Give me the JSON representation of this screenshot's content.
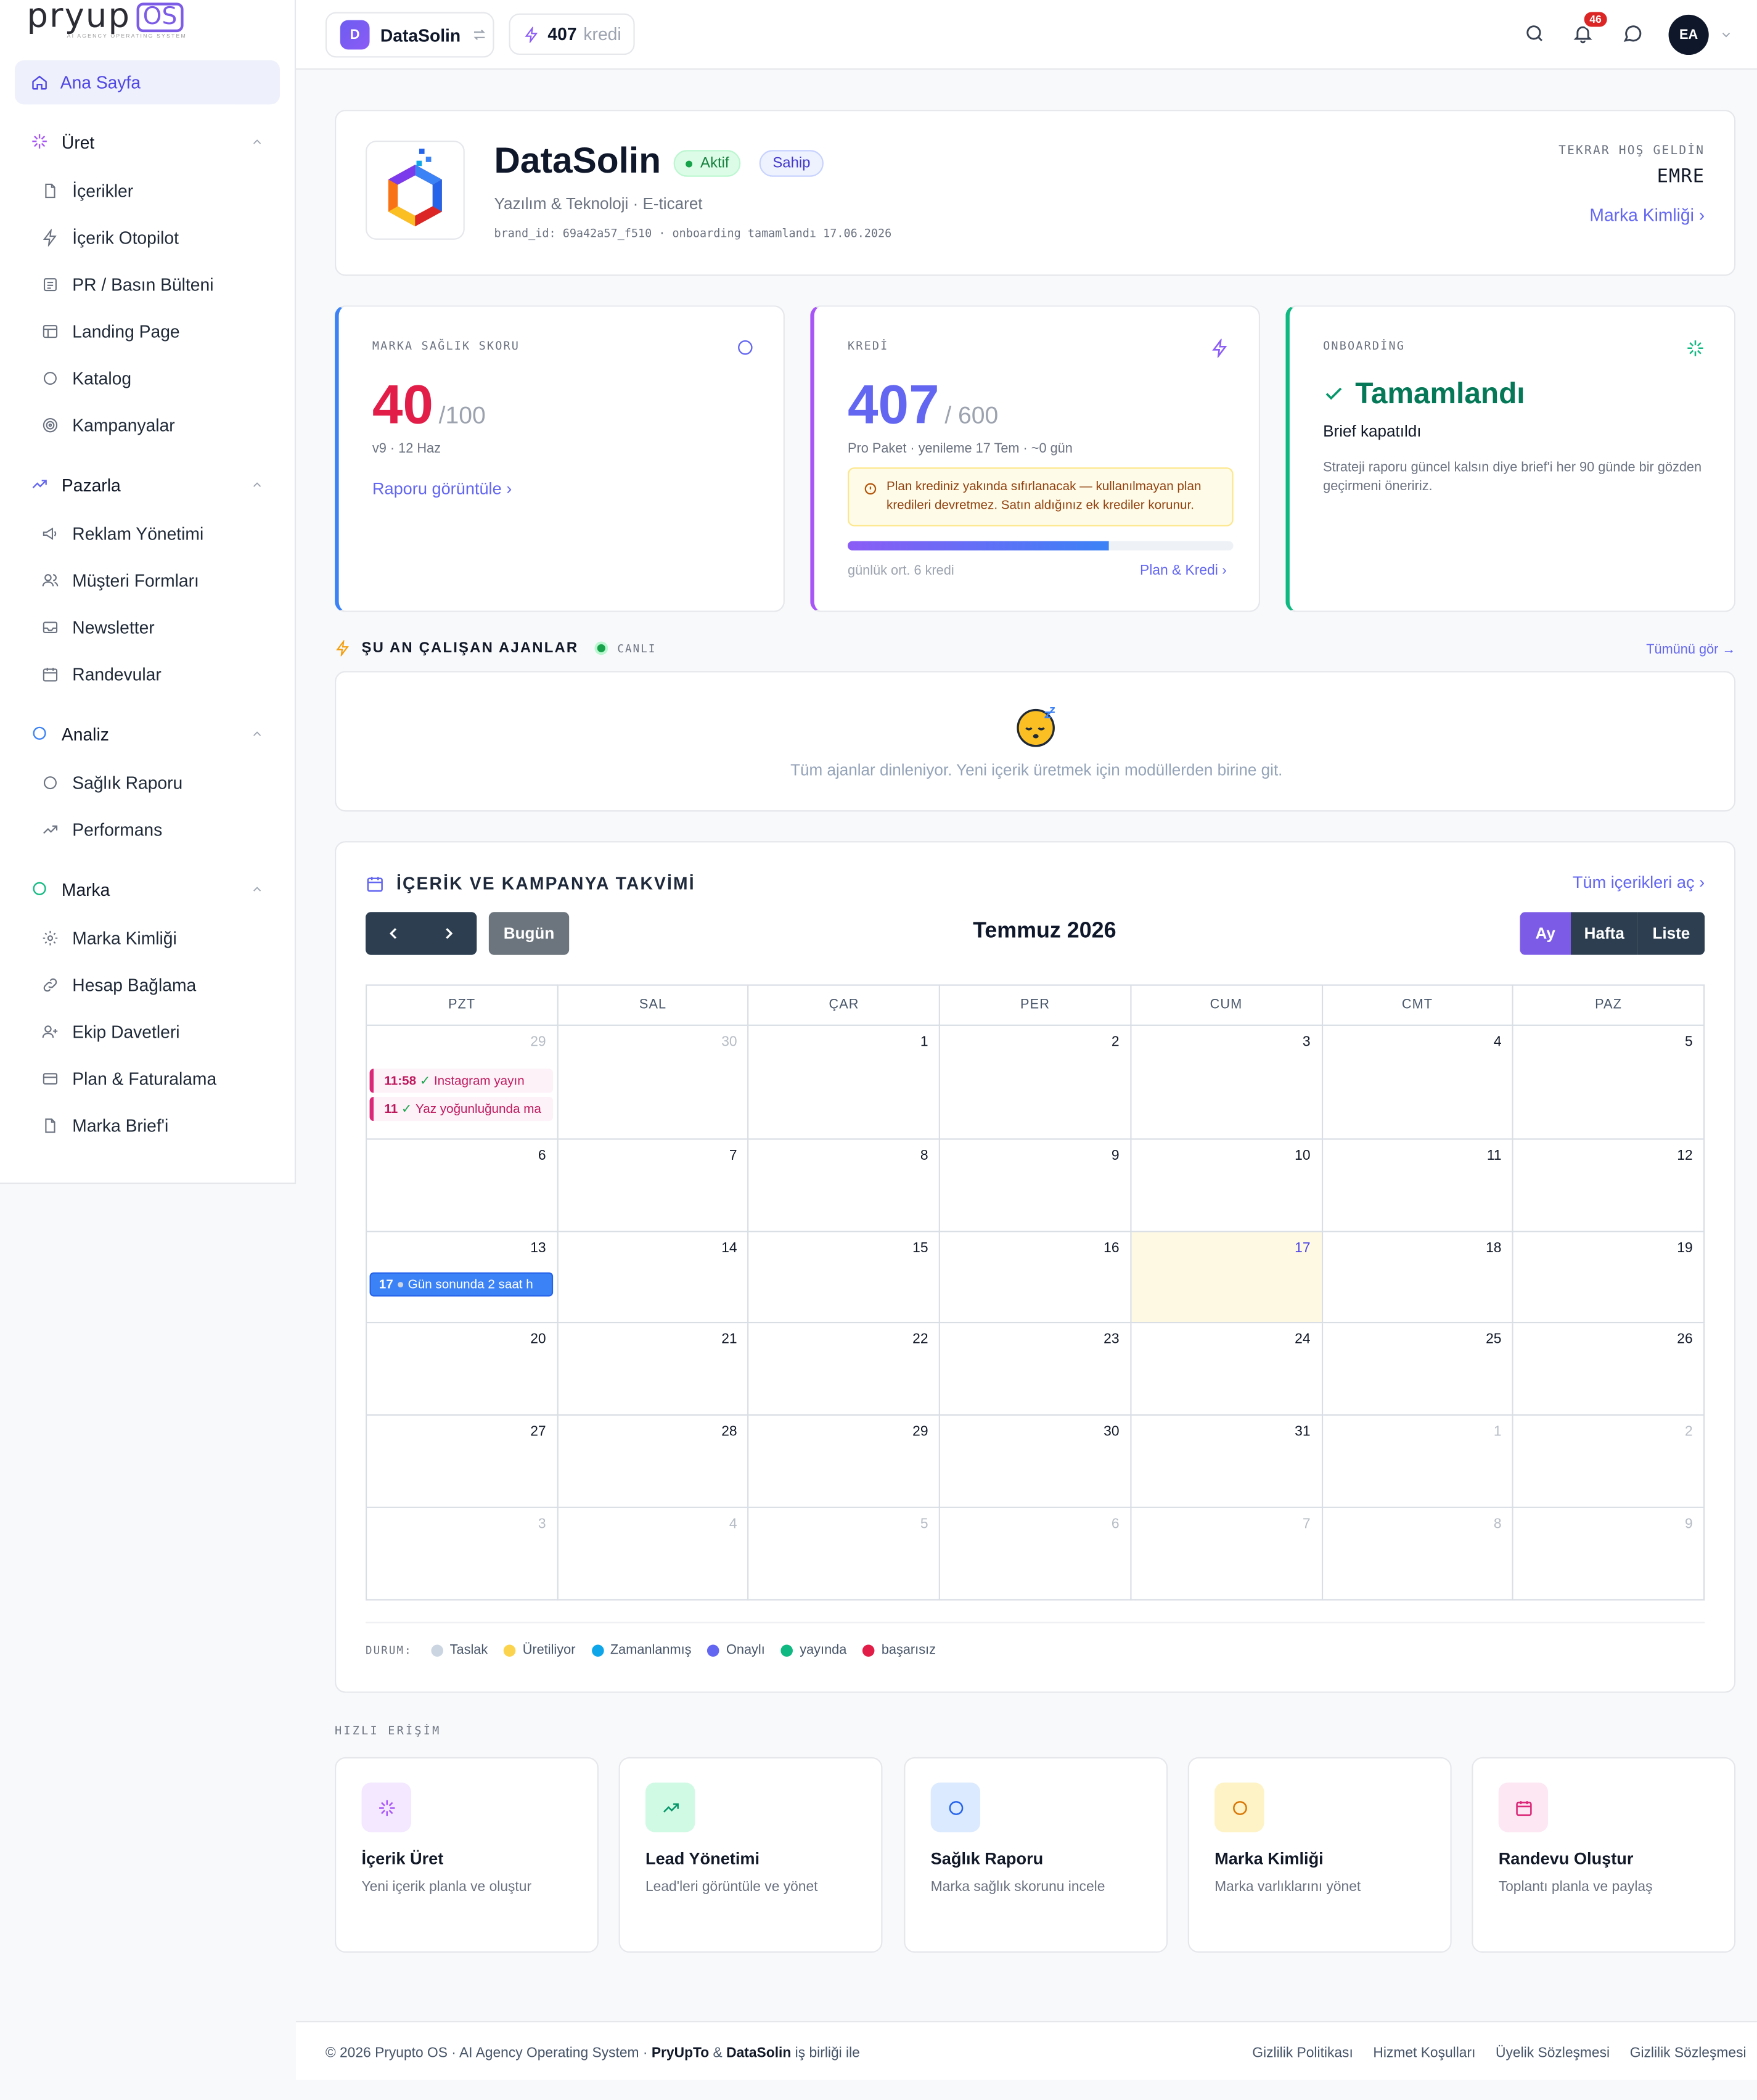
{
  "sidebar": {
    "logo_main": "pryup",
    "logo_os": "OS",
    "logo_sub": "AI AGENCY OPERATING SYSTEM",
    "home": "Ana Sayfa",
    "groups": [
      {
        "label": "Üret",
        "items": [
          "İçerikler",
          "İçerik Otopilot",
          "PR / Basın Bülteni",
          "Landing Page",
          "Katalog",
          "Kampanyalar"
        ]
      },
      {
        "label": "Pazarla",
        "items": [
          "Reklam Yönetimi",
          "Müşteri Formları",
          "Newsletter",
          "Randevular"
        ]
      },
      {
        "label": "Analiz",
        "items": [
          "Sağlık Raporu",
          "Performans"
        ]
      },
      {
        "label": "Marka",
        "items": [
          "Marka Kimliği",
          "Hesap Bağlama",
          "Ekip Davetleri",
          "Plan & Faturalama",
          "Marka Brief'i"
        ]
      }
    ]
  },
  "topbar": {
    "brand_initial": "D",
    "brand_name": "DataSolin",
    "credits": "407",
    "credits_unit": "kredi",
    "notification_count": "46",
    "avatar": "EA"
  },
  "hero": {
    "title": "DataSolin",
    "status": "Aktif",
    "role": "Sahip",
    "subtitle": "Yazılım & Teknoloji · E-ticaret",
    "meta": "brand_id: 69a42a57_f510 · onboarding tamamlandı 17.06.2026",
    "welcome_label": "TEKRAR HOŞ GELDİN",
    "user_name": "EMRE",
    "identity_link": "Marka Kimliği"
  },
  "health": {
    "label": "MARKA SAĞLIK SKORU",
    "score": "40",
    "unit": "/100",
    "sub": "v9 · 12 Haz",
    "link": "Raporu görüntüle"
  },
  "credit": {
    "label": "KREDİ",
    "value": "407",
    "unit": "/ 600",
    "sub": "Pro Paket · yenileme 17 Tem · ~0 gün",
    "warning": "Plan krediniz yakında sıfırlanacak — kullanılmayan plan kredileri devretmez. Satın aldığınız ek krediler korunur.",
    "used_fraction": 0.678,
    "daily": "günlük ort. 6 kredi",
    "link": "Plan & Kredi"
  },
  "onboarding": {
    "label": "ONBOARDİNG",
    "title": "Tamamlandı",
    "sub": "Brief kapatıldı",
    "desc": "Strateji raporu güncel kalsın diye brief'i her 90 günde bir gözden geçirmeni öneririz."
  },
  "agents": {
    "title": "ŞU AN ÇALIŞAN AJANLAR",
    "live": "CANLI",
    "see_all": "Tümünü gör →",
    "empty": "Tüm ajanlar dinleniyor. Yeni içerik üretmek için modüllerden birine git."
  },
  "calendar": {
    "title": "İÇERİK VE KAMPANYA TAKVİMİ",
    "open_all": "Tüm içerikleri aç",
    "today": "Bugün",
    "month": "Temmuz 2026",
    "views": [
      "Ay",
      "Hafta",
      "Liste"
    ],
    "weekdays": [
      "PZT",
      "SAL",
      "ÇAR",
      "PER",
      "CUM",
      "CMT",
      "PAZ"
    ],
    "weeks": [
      [
        "29",
        "30",
        "1",
        "2",
        "3",
        "4",
        "5"
      ],
      [
        "6",
        "7",
        "8",
        "9",
        "10",
        "11",
        "12"
      ],
      [
        "13",
        "14",
        "15",
        "16",
        "17",
        "18",
        "19"
      ],
      [
        "20",
        "21",
        "22",
        "23",
        "24",
        "25",
        "26"
      ],
      [
        "27",
        "28",
        "29",
        "30",
        "31",
        "1",
        "2"
      ],
      [
        "3",
        "4",
        "5",
        "6",
        "7",
        "8",
        "9"
      ]
    ],
    "events": [
      {
        "time": "11:58",
        "title": "Instagram yayın"
      },
      {
        "time": "11",
        "title": "Yaz yoğunluğunda ma"
      },
      {
        "time": "17",
        "title": "Gün sonunda 2 saat h"
      }
    ],
    "legend_title": "DURUM:",
    "legend": [
      {
        "label": "Taslak",
        "color": "#cbd5e1"
      },
      {
        "label": "Üretiliyor",
        "color": "#fcd34d"
      },
      {
        "label": "Zamanlanmış",
        "color": "#0ea5e9"
      },
      {
        "label": "Onaylı",
        "color": "#6366f1"
      },
      {
        "label": "yayında",
        "color": "#10b981"
      },
      {
        "label": "başarısız",
        "color": "#e11d48"
      }
    ]
  },
  "quick": {
    "label": "HIZLI ERİŞİM",
    "items": [
      {
        "title": "İçerik Üret",
        "desc": "Yeni içerik planla ve oluştur"
      },
      {
        "title": "Lead Yönetimi",
        "desc": "Lead'leri görüntüle ve yönet"
      },
      {
        "title": "Sağlık Raporu",
        "desc": "Marka sağlık skorunu incele"
      },
      {
        "title": "Marka Kimliği",
        "desc": "Marka varlıklarını yönet"
      },
      {
        "title": "Randevu Oluştur",
        "desc": "Toplantı planla ve paylaş"
      }
    ]
  },
  "footer": {
    "copyright": "© 2026 Pryupto OS · AI Agency Operating System · ",
    "partner1": "PryUpTo",
    "amp": " & ",
    "partner2": "DataSolin",
    "suffix": " iş birliği ile",
    "links": [
      "Gizlilik Politikası",
      "Hizmet Koşulları",
      "Üyelik Sözleşmesi",
      "Gizlilik Sözleşmesi"
    ]
  }
}
